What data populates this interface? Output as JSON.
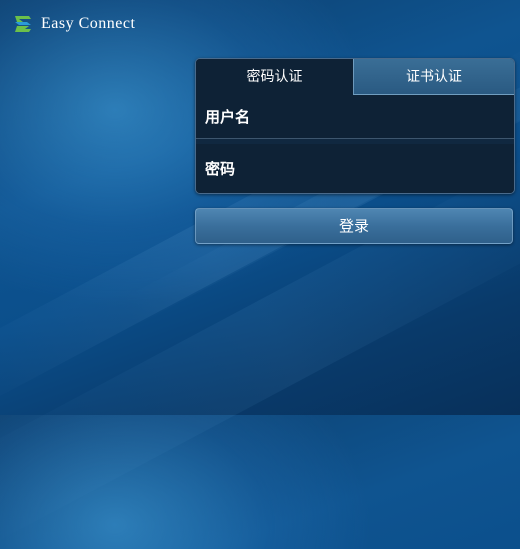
{
  "app": {
    "brand_name": "Easy Connect",
    "logo_icon": "easyconnect-logo-icon"
  },
  "login": {
    "tabs": [
      {
        "label": "密码认证",
        "active": true
      },
      {
        "label": "证书认证",
        "active": false
      }
    ],
    "username": {
      "placeholder": "用户名",
      "value": ""
    },
    "password": {
      "placeholder": "密码",
      "value": ""
    },
    "submit_label": "登录"
  },
  "colors": {
    "background": "#0f5490",
    "card": "#0e2236",
    "inactive_tab": "#2a5a82",
    "button": "#3a6f9c",
    "logo_green": "#6cc04a",
    "logo_blue": "#2a9bd8",
    "text": "#ffffff"
  }
}
